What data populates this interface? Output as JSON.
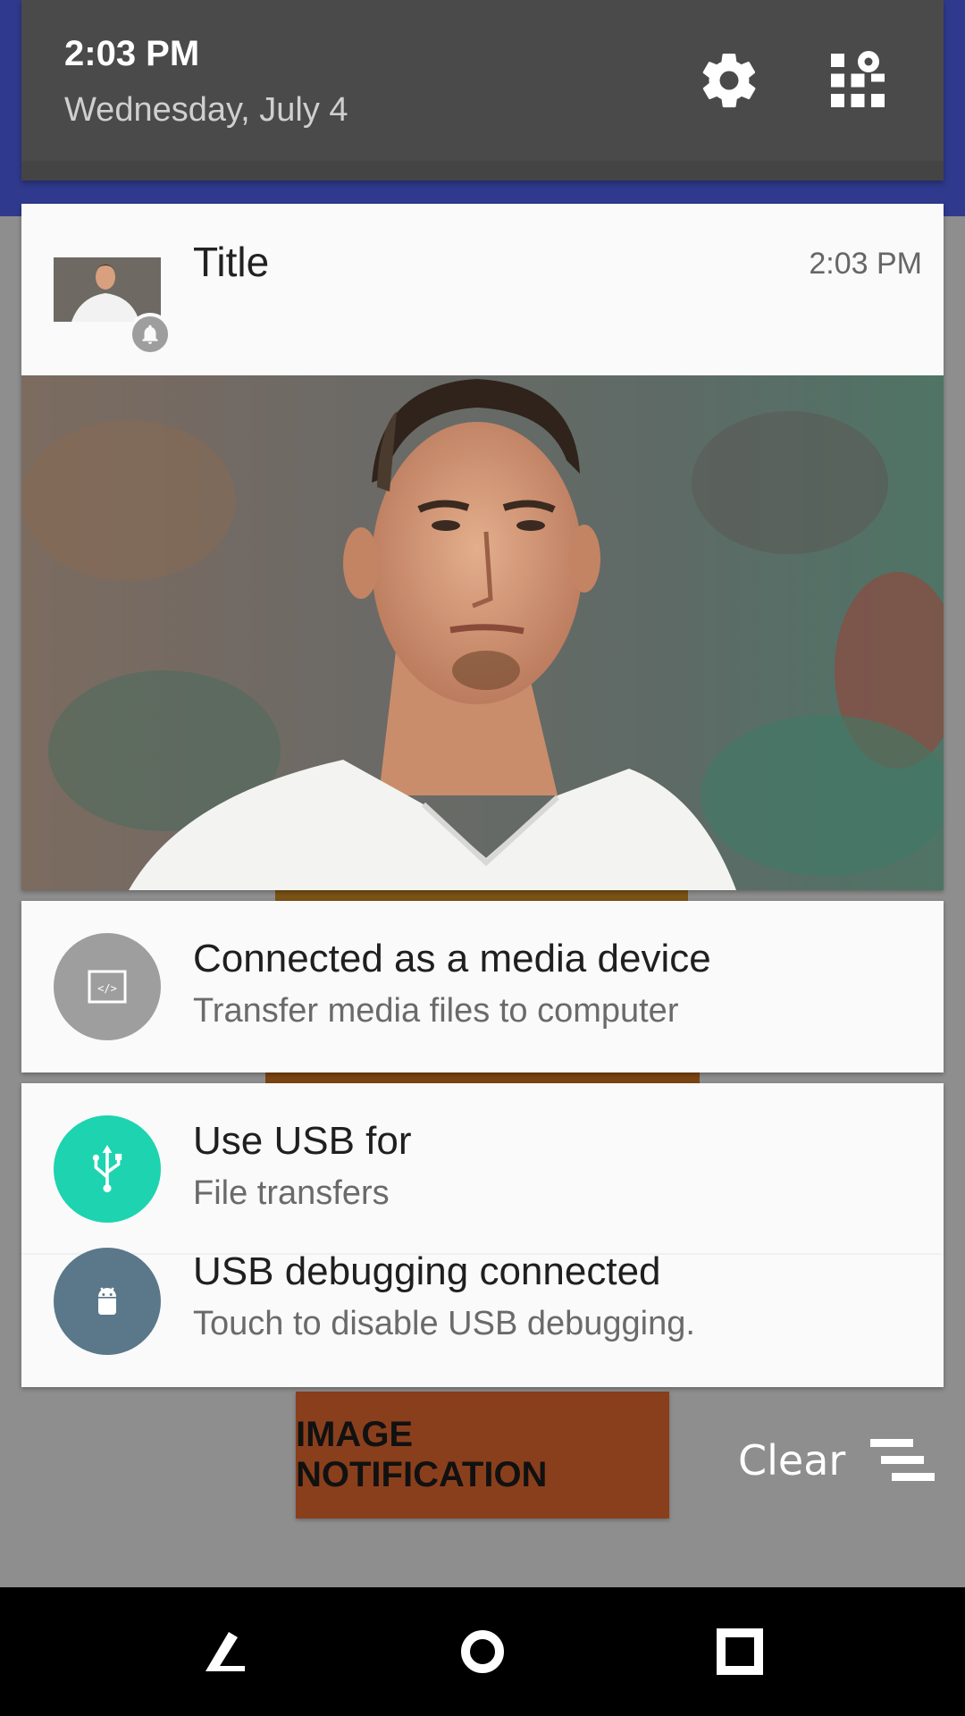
{
  "status": {
    "time": "2:03 PM",
    "date": "Wednesday, July 4"
  },
  "icons": {
    "settings": "gear-icon",
    "tiles": "quick-settings-grid-icon",
    "app_badge": "bell-icon",
    "media": "code-icon",
    "usb": "usb-icon",
    "debug": "android-icon",
    "clear": "clear-all-icon"
  },
  "image_notification": {
    "title": "Title",
    "time": "2:03 PM"
  },
  "notifications": [
    {
      "title": "Connected as a media device",
      "subtitle": "Transfer media files to computer",
      "icon_color": "#9e9e9e"
    },
    {
      "title": "Use USB for",
      "subtitle": "File transfers",
      "icon_color": "#1dd3b0"
    },
    {
      "title": "USB debugging connected",
      "subtitle": "Touch to disable USB debugging.",
      "icon_color": "#5a7889"
    }
  ],
  "app": {
    "button_label": "IMAGE NOTIFICATION"
  },
  "shade": {
    "clear_label": "Clear"
  },
  "colors": {
    "app_bar": "#2f3a8e",
    "button": "#8a3f1c",
    "qs_header": "#4a4a4a"
  }
}
